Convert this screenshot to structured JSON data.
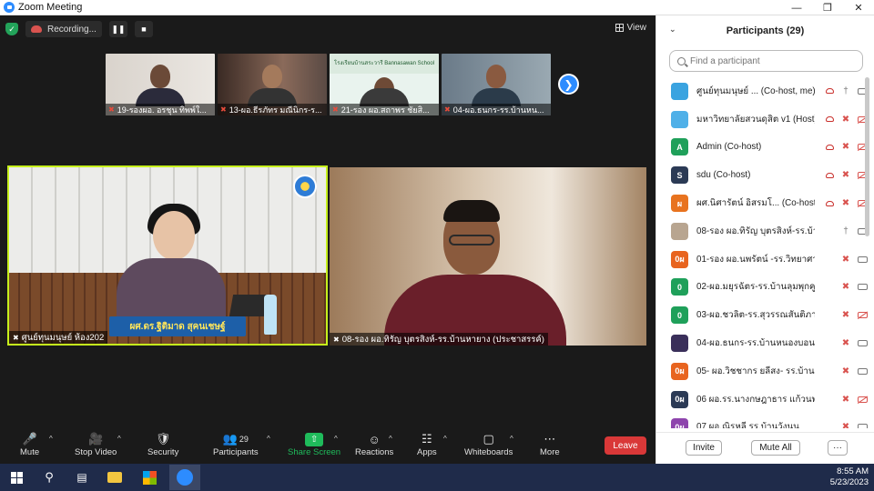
{
  "window": {
    "title": "Zoom Meeting"
  },
  "recording": {
    "label": "Recording..."
  },
  "view": {
    "label": "View"
  },
  "thumbnails": [
    {
      "label": "19-รองผอ. อรชุน ทิพพ์ใ..."
    },
    {
      "label": "13-ผอ.ธีรภัทร มณีนิกร-ร..."
    },
    {
      "label": "21-รอง ผอ.สถาพร ชัยสิ..."
    },
    {
      "label": "04-ผอ.ธนกร-รร.บ้านหน..."
    }
  ],
  "thumb_sign": "โรงเรียนบ้านสระวารี Bannasawan School",
  "speaker": {
    "label": "ศูนย์ทุนมนุษย์ ห้อง202",
    "nameplate": "ผศ.ดร.ฐิติมาด สุคนเชษฐ์"
  },
  "guest": {
    "label": "08-รอง ผอ.ทิรัญ บุตรสิงห์-รร.บ้านหายาง (ประชาสรรค์)"
  },
  "toolbar": {
    "mute": "Mute",
    "stop_video": "Stop Video",
    "security": "Security",
    "participants": "Participants",
    "participants_count": "29",
    "share_screen": "Share Screen",
    "reactions": "Reactions",
    "apps": "Apps",
    "whiteboards": "Whiteboards",
    "more": "More",
    "leave": "Leave"
  },
  "panel": {
    "title": "Participants (29)",
    "search_placeholder": "Find a participant",
    "invite": "Invite",
    "mute_all": "Mute All",
    "more": "···",
    "participants": [
      {
        "initial": "",
        "avatar_color": "#3aa3e0",
        "name": "ศูนย์ทุนมนุษย์ ... (Co-host, me)",
        "record": true,
        "mic": "on",
        "cam": "on"
      },
      {
        "initial": "",
        "avatar_color": "#4fb0e8",
        "name": "มหาวิทยาลัยสวนดุสิต v1 (Host)",
        "record": true,
        "mic": "off",
        "cam": "off"
      },
      {
        "initial": "A",
        "avatar_color": "#1fa05a",
        "name": "Admin (Co-host)",
        "record": true,
        "mic": "off",
        "cam": "off"
      },
      {
        "initial": "S",
        "avatar_color": "#2b3a55",
        "name": "sdu (Co-host)",
        "record": true,
        "mic": "off",
        "cam": "off"
      },
      {
        "initial": "ผ",
        "avatar_color": "#e8731f",
        "name": "ผศ.นิศารัตน์ อิสรมโ... (Co-host)",
        "record": true,
        "mic": "off",
        "cam": "off"
      },
      {
        "initial": "",
        "avatar_color": "#b8a590",
        "name": "08-รอง ผอ.ทิรัญ บุตรสิงห์-รร.บ้านห...",
        "record": false,
        "mic": "on",
        "cam": "on"
      },
      {
        "initial": "0ผ",
        "avatar_color": "#e8641f",
        "name": "01-รอง ผอ.นพรัตน์ -รร.วิทยาศาสตร์...",
        "record": false,
        "mic": "off",
        "cam": "on"
      },
      {
        "initial": "0",
        "avatar_color": "#1fa05a",
        "name": "02-ผอ.มยุรฉัตร-รร.บ้านลุมพุกคูวงส์",
        "record": false,
        "mic": "off",
        "cam": "on"
      },
      {
        "initial": "0",
        "avatar_color": "#1fa05a",
        "name": "03-ผอ.ชวลิต-รร.สุวรรณสันติภาพ...",
        "record": false,
        "mic": "off",
        "cam": "off"
      },
      {
        "initial": "",
        "avatar_color": "#3a2f5a",
        "name": "04-ผอ.ธนกร-รร.บ้านหนองบอน",
        "record": false,
        "mic": "off",
        "cam": "on"
      },
      {
        "initial": "0ผ",
        "avatar_color": "#e8641f",
        "name": "05- ผอ.วิชชากร ยลีสง- รร.บ้านยาง",
        "record": false,
        "mic": "off",
        "cam": "on"
      },
      {
        "initial": "0ผ",
        "avatar_color": "#2b3a55",
        "name": "06 ผอ.รร.นางกษฎาธาร แก้วนพรัตน์...",
        "record": false,
        "mic": "off",
        "cam": "off"
      },
      {
        "initial": "0ผ",
        "avatar_color": "#8e44ad",
        "name": "07 ผอ.ณิรหลี รร.บ้านวังนน",
        "record": false,
        "mic": "off",
        "cam": "on"
      }
    ]
  },
  "clock": {
    "time": "8:55 AM",
    "date": "5/23/2023"
  }
}
